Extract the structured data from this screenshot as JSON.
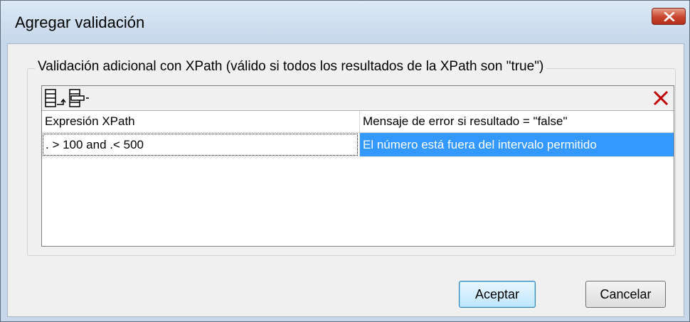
{
  "window": {
    "title": "Agregar validación"
  },
  "group": {
    "label": "Validación adicional con XPath (válido si todos los resultados de la XPath son \"true\")"
  },
  "grid": {
    "columns": [
      "Expresión XPath",
      "Mensaje de error si resultado = \"false\""
    ],
    "rows": [
      {
        "expression": ". > 100 and .< 500",
        "message": "El número está fuera del intervalo permitido"
      }
    ]
  },
  "buttons": {
    "ok_label": "Aceptar",
    "cancel_label": "Cancelar"
  },
  "icons": {
    "append_row": "append-row-icon",
    "insert_row": "insert-row-icon",
    "delete_row": "delete-x-icon",
    "close": "close-icon"
  },
  "colors": {
    "selection": "#3399ff",
    "close_button": "#c8442b",
    "delete_icon": "#c00000"
  }
}
